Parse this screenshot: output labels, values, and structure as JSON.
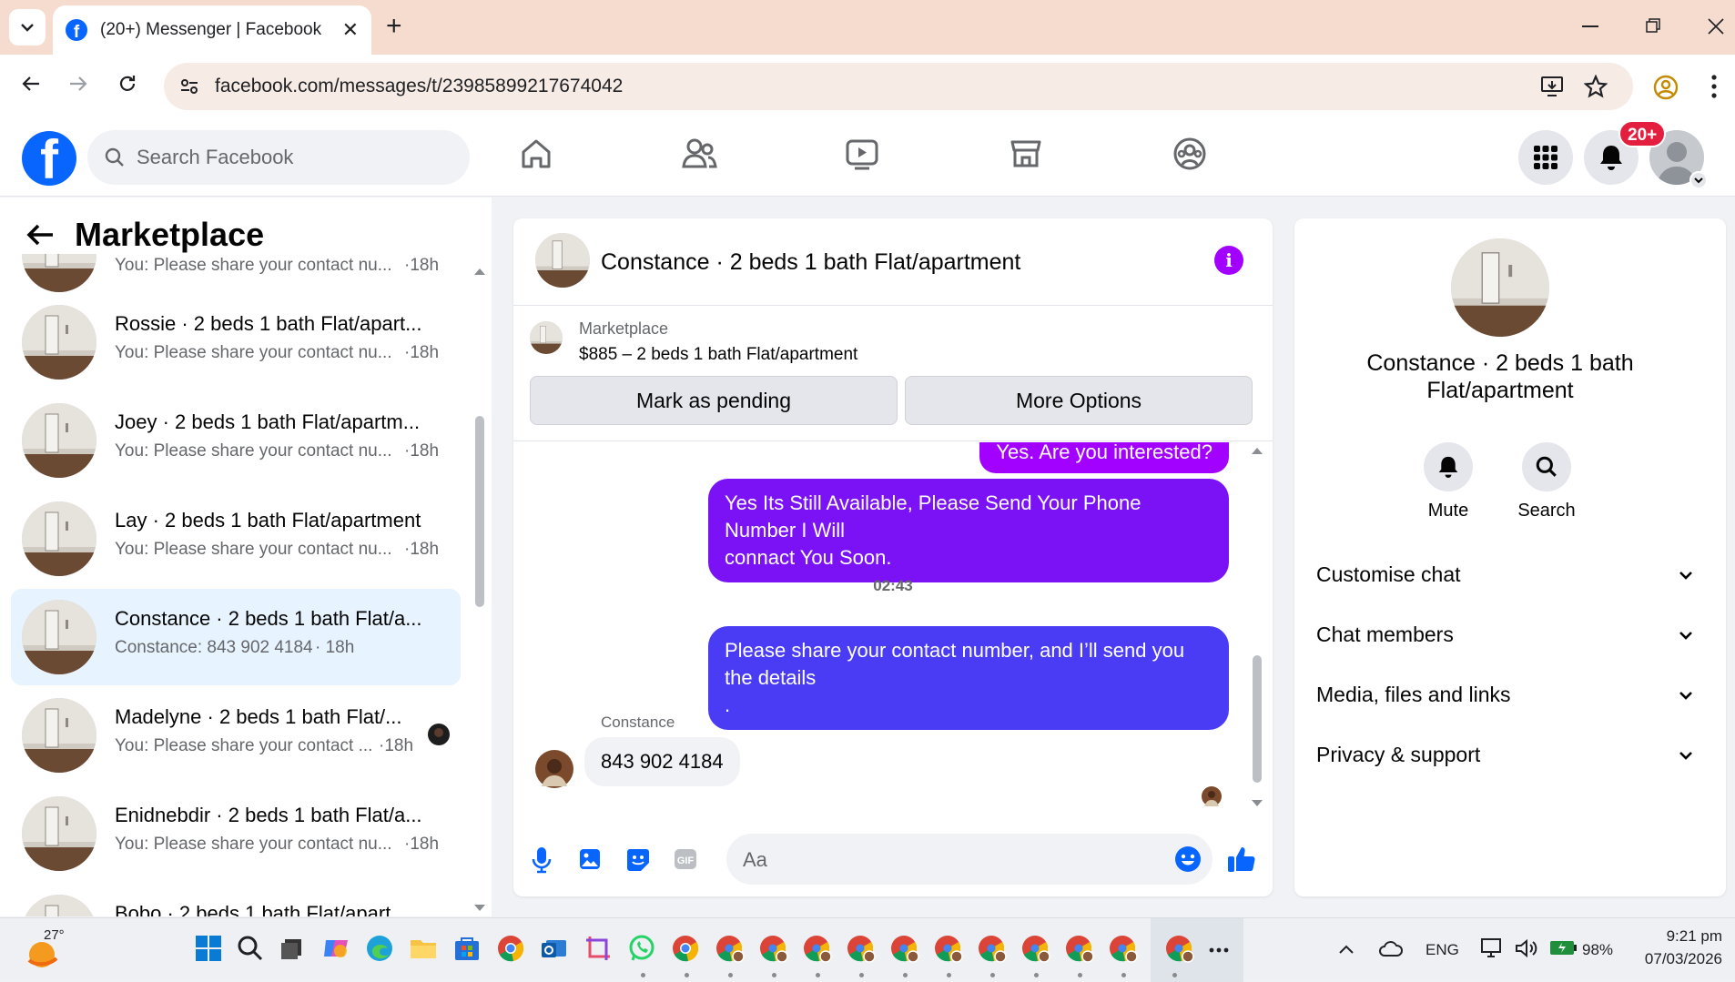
{
  "browser": {
    "tab_title": "(20+) Messenger | Facebook",
    "url": "facebook.com/messages/t/23985899217674042"
  },
  "fb_header": {
    "search_placeholder": "Search Facebook",
    "notification_badge": "20+"
  },
  "left_panel": {
    "title": "Marketplace",
    "partial_top_preview": "You: Please share your contact nu...",
    "partial_top_time": "·18h",
    "conversations": [
      {
        "name": "Rossie · 2 beds 1 bath Flat/apart...",
        "preview": "You: Please share your contact nu...",
        "time": "·18h"
      },
      {
        "name": "Joey · 2 beds 1 bath Flat/apartm...",
        "preview": "You: Please share your contact nu...",
        "time": "·18h"
      },
      {
        "name": "Lay · 2 beds 1 bath Flat/apartment",
        "preview": "You: Please share your contact nu...",
        "time": "·18h"
      },
      {
        "name": "Constance · 2 beds 1 bath Flat/a...",
        "preview": "Constance: 843 902 4184",
        "time": "· 18h"
      },
      {
        "name": "Madelyne · 2 beds 1 bath Flat/...",
        "preview": "You: Please share your contact ...",
        "time": "·18h"
      },
      {
        "name": "Enidnebdir · 2 beds 1 bath Flat/a...",
        "preview": "You: Please share your contact nu...",
        "time": "·18h"
      }
    ],
    "partial_bottom_name": "Bobo · 2 beds 1 bath Flat/apart..."
  },
  "chat": {
    "title": "Constance · 2 beds 1 bath Flat/apartment",
    "marketplace_label": "Marketplace",
    "listing": "$885 – 2 beds 1 bath Flat/apartment",
    "mark_pending": "Mark as pending",
    "more_options": "More Options",
    "messages": {
      "msg1": "Yes. Are you interested?",
      "msg2_line1": "Yes Its Still Available, Please Send Your Phone Number I Will",
      "msg2_line2": "connact You Soon.",
      "timestamp": "02:43",
      "msg3_line1": "Please share your contact number, and I’ll send you the details",
      "msg3_line2": ".",
      "sender": "Constance",
      "msg4": "843 902 4184"
    },
    "composer_placeholder": "Aa"
  },
  "right_panel": {
    "name_line1": "Constance · 2 beds 1 bath",
    "name_line2": "Flat/apartment",
    "mute": "Mute",
    "search": "Search",
    "sections": [
      "Customise chat",
      "Chat members",
      "Media, files and links",
      "Privacy & support"
    ]
  },
  "taskbar": {
    "weather": "27°",
    "language": "ENG",
    "battery": "98%",
    "time": "9:21 pm",
    "date": "07/03/2026"
  },
  "colors": {
    "facebook_blue": "#0866ff",
    "bubble_purple": "#a200ff",
    "bubble_violet": "#7a12f5",
    "bubble_blue": "#4a3cf5",
    "active_row": "#e7f3ff"
  }
}
